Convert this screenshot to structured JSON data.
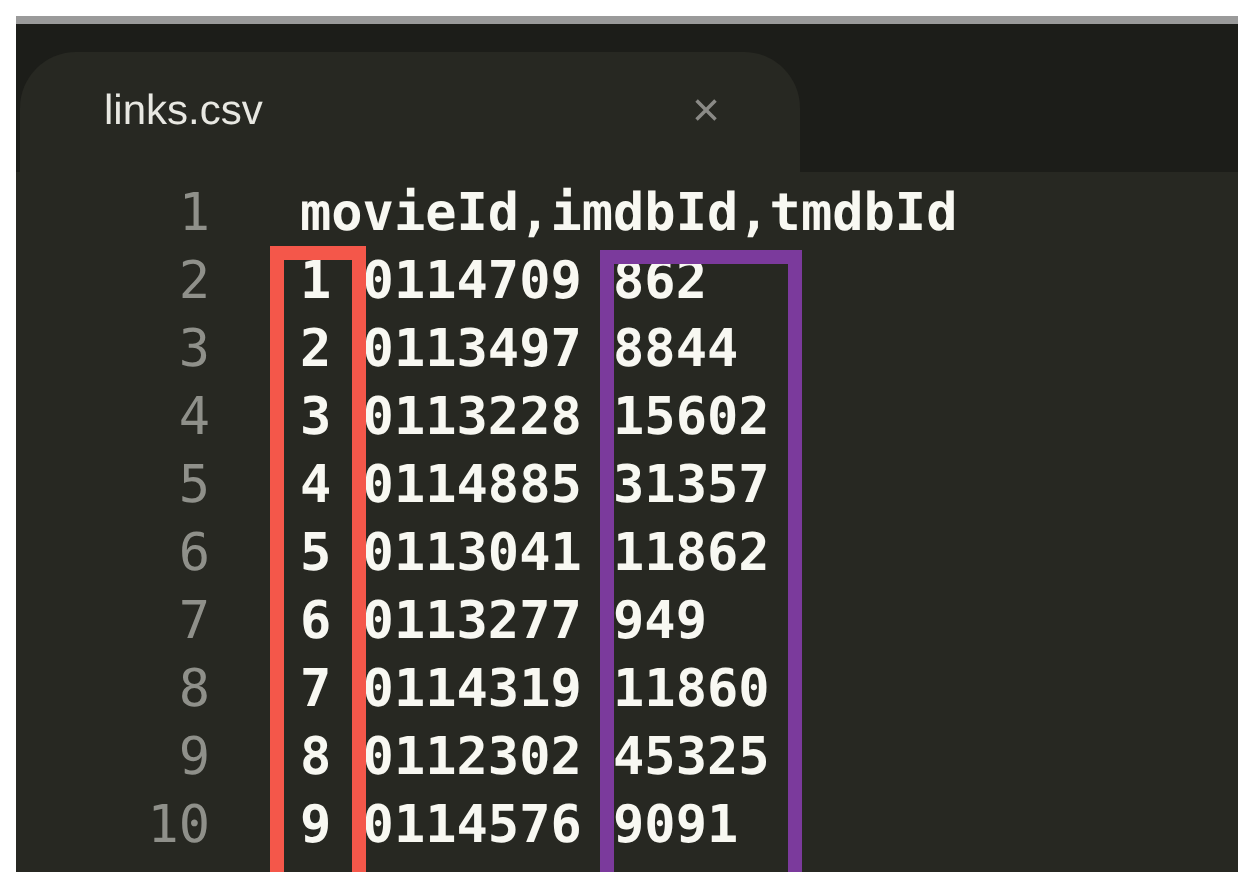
{
  "tab": {
    "title": "links.csv",
    "close": "×",
    "selected": true
  },
  "lines": [
    {
      "number": "1",
      "kind": "header",
      "text": "movieId,imdbId,tmdbId"
    },
    {
      "number": "2",
      "kind": "row",
      "cells": [
        "1",
        "0114709",
        "862"
      ]
    },
    {
      "number": "3",
      "kind": "row",
      "cells": [
        "2",
        "0113497",
        "8844"
      ]
    },
    {
      "number": "4",
      "kind": "row",
      "cells": [
        "3",
        "0113228",
        "15602"
      ]
    },
    {
      "number": "5",
      "kind": "row",
      "cells": [
        "4",
        "0114885",
        "31357"
      ]
    },
    {
      "number": "6",
      "kind": "row",
      "cells": [
        "5",
        "0113041",
        "11862"
      ]
    },
    {
      "number": "7",
      "kind": "row",
      "cells": [
        "6",
        "0113277",
        "949"
      ]
    },
    {
      "number": "8",
      "kind": "row",
      "cells": [
        "7",
        "0114319",
        "11860"
      ]
    },
    {
      "number": "9",
      "kind": "row",
      "cells": [
        "8",
        "0112302",
        "45325"
      ]
    },
    {
      "number": "10",
      "kind": "row",
      "cells": [
        "9",
        "0114576",
        "9091"
      ]
    }
  ],
  "highlights": [
    {
      "color": "#f4574a"
    },
    {
      "color": "#7b3a9c"
    }
  ]
}
